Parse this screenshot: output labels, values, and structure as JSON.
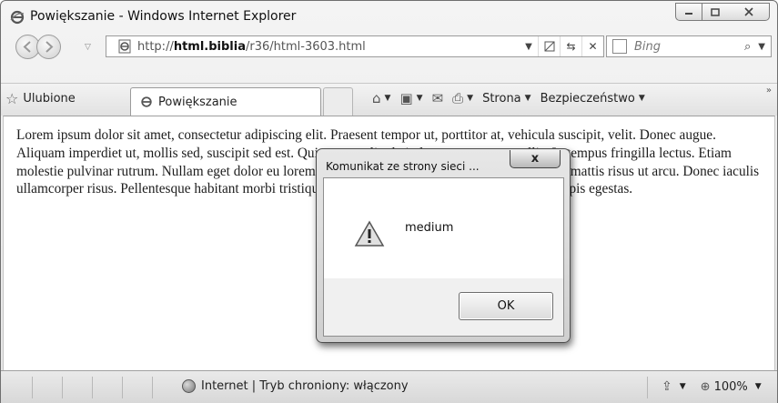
{
  "window": {
    "title": "Powiększanie - Windows Internet Explorer"
  },
  "address": {
    "url_prefix": "http://",
    "url_host": "html.biblia",
    "url_path": "/r36/html-3603.html"
  },
  "search": {
    "placeholder": "Bing"
  },
  "favorites": {
    "label": "Ulubione"
  },
  "tab": {
    "label": "Powiększanie"
  },
  "commandbar": {
    "page_label": "Strona",
    "safety_label": "Bezpieczeństwo"
  },
  "page": {
    "text": "Lorem ipsum dolor sit amet, consectetur adipiscing elit. Praesent tempor ut, porttitor at, vehicula suscipit, velit. Donec augue. Aliquam imperdiet ut, mollis sed, suscipit sed est. Quisque nec ligula in lectus cursus convallis. In tempus fringilla lectus. Etiam molestie pulvinar rutrum. Nullam eget dolor eu lorem pellentesque elementum. Sed tempus mauris mattis risus ut arcu. Donec iaculis ullamcorper risus. Pellentesque habitant morbi tristique senectus et netus et malesuada fames ac turpis egestas."
  },
  "dialog": {
    "title": "Komunikat ze strony sieci ...",
    "message": "medium",
    "ok_label": "OK",
    "close_label": "x"
  },
  "statusbar": {
    "zone_text": "Internet | Tryb chroniony: włączony",
    "zoom": "100%"
  },
  "colors": {
    "chrome": "#e6e6e6",
    "content_bg": "#ffffff"
  }
}
